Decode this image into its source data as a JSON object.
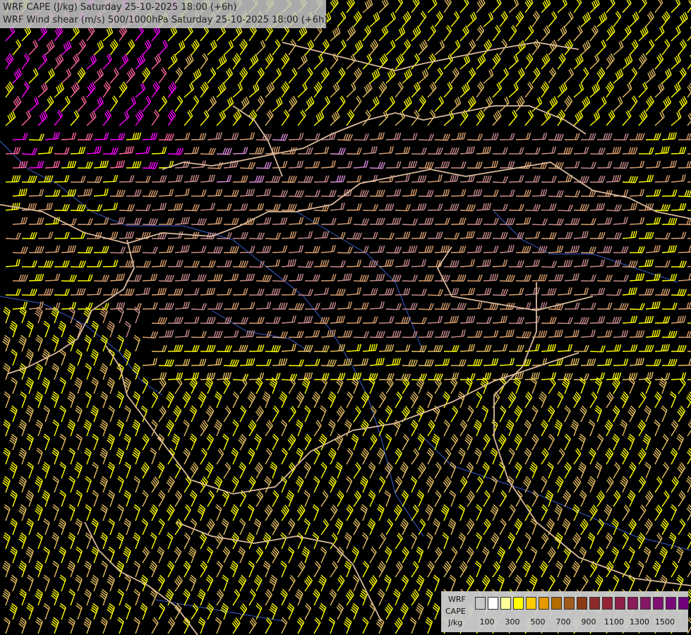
{
  "title": {
    "line1": "WRF CAPE (J/kg) Saturday 25-10-2025 18:00 (+6h)",
    "line2": "WRF Wind shear (m/s) 500/1000hPa Saturday 25-10-2025 18:00 (+6h)"
  },
  "legend": {
    "line1": "WRF",
    "line2": "CAPE",
    "unit": "J/kg",
    "colors": [
      "#c8c8c8",
      "#ffffff",
      "#ffff99",
      "#ffff00",
      "#ffcc00",
      "#e69900",
      "#b36b00",
      "#a05a1a",
      "#8a3a14",
      "#8c2a2a",
      "#932438",
      "#8f1f48",
      "#8a1a58",
      "#851565",
      "#801070",
      "#7a0a7a",
      "#70007a"
    ],
    "tick_labels": [
      "100",
      "300",
      "500",
      "700",
      "900",
      "1100",
      "1300",
      "1500"
    ]
  },
  "map": {
    "background": "#000000",
    "border_color": "#d9b99b",
    "river_color": "#3a5fcd",
    "barb_colors": [
      "#ffff00",
      "#e6c060",
      "#d9a070",
      "#c88c8c",
      "#d98cd9",
      "#ff66a0",
      "#ff00ff"
    ]
  }
}
